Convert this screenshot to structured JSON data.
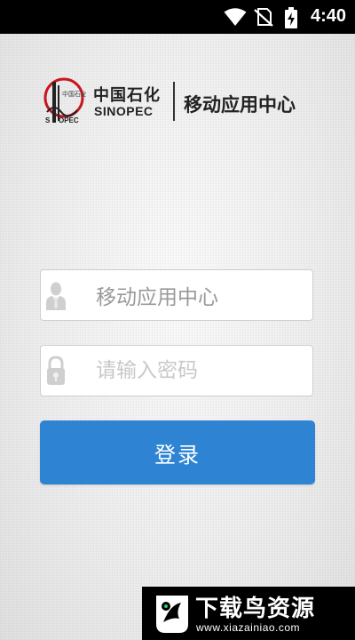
{
  "status_bar": {
    "time": "4:40",
    "icons": [
      "wifi-icon",
      "no-sim-icon",
      "battery-charging-icon"
    ]
  },
  "header": {
    "company_name_cn": "中国石化",
    "company_name_en": "SINOPEC",
    "app_title": "移动应用中心",
    "logo_icon": "sinopec-logo-icon"
  },
  "login_form": {
    "username_value": "移动应用中心",
    "password_placeholder": "请输入密码",
    "login_button_label": "登录",
    "accent_color": "#2e84d3"
  },
  "watermark": {
    "title": "下载鸟资源",
    "url": "www.xiazainiao.com"
  }
}
